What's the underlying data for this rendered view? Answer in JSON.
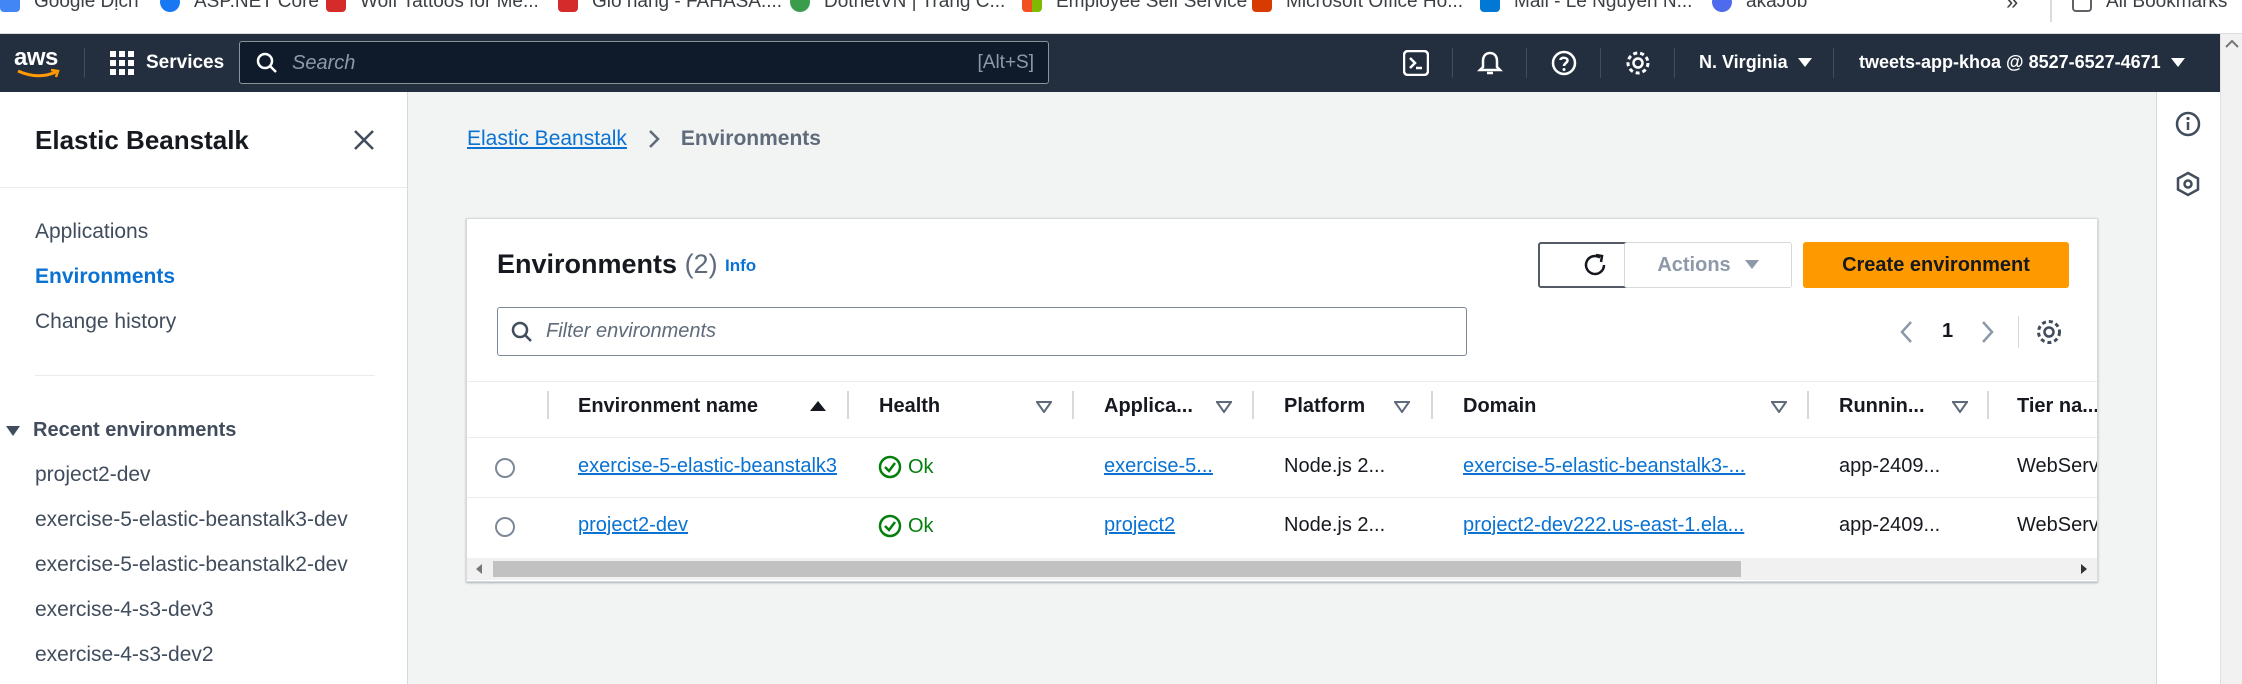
{
  "bookmarks": [
    {
      "label": "Google Dịch",
      "color": "#4285f4"
    },
    {
      "label": "ASP.NET Core",
      "color": "#1877f2"
    },
    {
      "label": "Wolf Tattoos for Me...",
      "color": "#d62b2b"
    },
    {
      "label": "Giỏ hàng - FAHASA....",
      "color": "#d62b2b"
    },
    {
      "label": "DotnetVN | Trang C...",
      "color": "#3a9d4e"
    },
    {
      "label": "Employee Self Service",
      "color": "#f25022"
    },
    {
      "label": "Microsoft Office Ho...",
      "color": "#d83b01"
    },
    {
      "label": "Mail - Le Nguyen N...",
      "color": "#0078d4"
    },
    {
      "label": "akaJob",
      "color": "#4f6bed"
    }
  ],
  "bookmarks_overflow": "»",
  "all_bookmarks": "All Bookmarks",
  "topnav": {
    "logo": "aws",
    "services": "Services",
    "search_placeholder": "Search",
    "search_shortcut": "[Alt+S]",
    "region": "N. Virginia",
    "account": "tweets-app-khoa @ 8527-6527-4671"
  },
  "sidebar": {
    "title": "Elastic Beanstalk",
    "items": [
      {
        "label": "Applications",
        "active": false
      },
      {
        "label": "Environments",
        "active": true
      },
      {
        "label": "Change history",
        "active": false
      }
    ],
    "recent_title": "Recent environments",
    "recent": [
      "project2-dev",
      "exercise-5-elastic-beanstalk3-dev",
      "exercise-5-elastic-beanstalk2-dev",
      "exercise-4-s3-dev3",
      "exercise-4-s3-dev2"
    ]
  },
  "breadcrumb": {
    "parent": "Elastic Beanstalk",
    "current": "Environments"
  },
  "panel": {
    "title": "Environments",
    "count": "(2)",
    "info": "Info",
    "actions": "Actions",
    "create": "Create environment",
    "filter_placeholder": "Filter environments",
    "page": "1"
  },
  "table": {
    "columns": [
      "Environment name",
      "Health",
      "Applica...",
      "Platform",
      "Domain",
      "Runnin...",
      "Tier na..."
    ],
    "rows": [
      {
        "name": "exercise-5-elastic-beanstalk3",
        "health": "Ok",
        "application": "exercise-5...",
        "platform": "Node.js 2...",
        "domain": "exercise-5-elastic-beanstalk3-...",
        "running": "app-2409...",
        "tier": "WebServ"
      },
      {
        "name": "project2-dev",
        "health": "Ok",
        "application": "project2",
        "platform": "Node.js 2...",
        "domain": "project2-dev222.us-east-1.ela...",
        "running": "app-2409...",
        "tier": "WebServ"
      }
    ]
  },
  "colors": {
    "nav_bg": "#232f3e",
    "link": "#0972d3",
    "primary_button": "#ff9900",
    "success": "#037f0c"
  }
}
